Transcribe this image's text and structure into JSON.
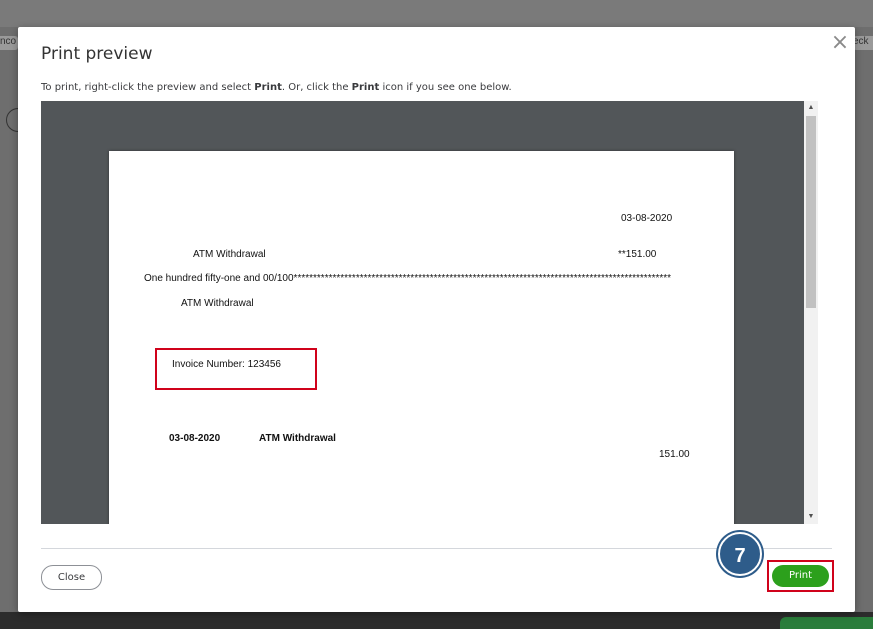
{
  "background": {
    "left_fragment": "nco",
    "right_fragment": "eck"
  },
  "dialog": {
    "title": "Print preview",
    "instructions": {
      "part1": "To print, right-click the preview and select ",
      "print1": "Print",
      "part2": ". Or, click the ",
      "print2": "Print",
      "part3": " icon if you see one below."
    },
    "close_icon": "×"
  },
  "check": {
    "date": "03-08-2020",
    "payee": "ATM Withdrawal",
    "amount": "**151.00",
    "amount_words": "One hundred fifty-one and 00/100*************************************************************************************************",
    "payee_address": "ATM Withdrawal",
    "memo": "Invoice Number: 123456",
    "stub_date": "03-08-2020",
    "stub_payee": "ATM Withdrawal",
    "stub_amount": "151.00"
  },
  "footer": {
    "close_label": "Close",
    "print_label": "Print"
  },
  "annotation": {
    "step_number": "7",
    "highlight_color": "#d0021b",
    "badge_color": "#2e5c8a"
  },
  "colors": {
    "print_button": "#2ca01c",
    "preview_background": "#525659"
  }
}
